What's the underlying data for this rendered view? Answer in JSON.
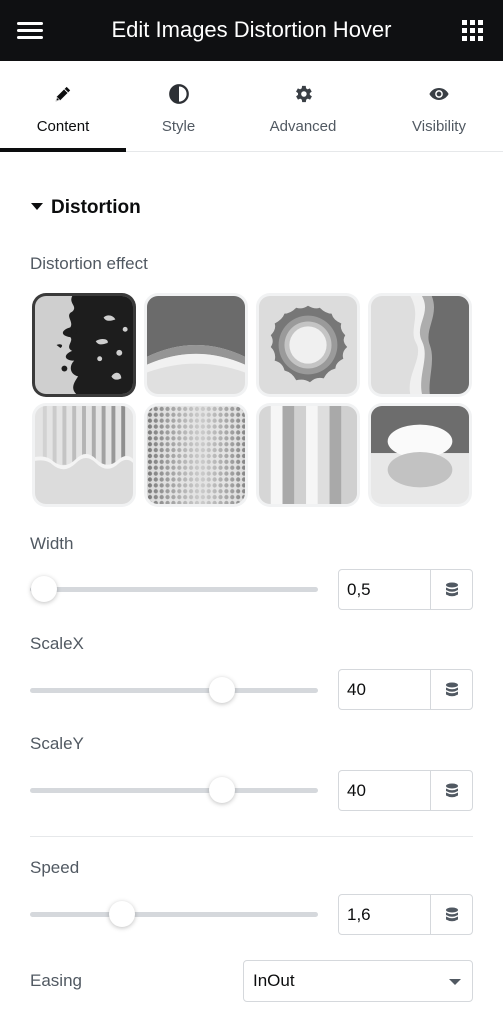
{
  "header": {
    "title": "Edit Images Distortion Hover",
    "menu_icon": "hamburger-icon",
    "apps_icon": "grid-icon"
  },
  "tabs": [
    {
      "label": "Content",
      "icon": "pencil-icon",
      "active": true
    },
    {
      "label": "Style",
      "icon": "half-circle-icon",
      "active": false
    },
    {
      "label": "Advanced",
      "icon": "gear-icon",
      "active": false
    },
    {
      "label": "Visibility",
      "icon": "eye-icon",
      "active": false
    }
  ],
  "section": {
    "title": "Distortion",
    "expanded": true
  },
  "distortion_effect": {
    "label": "Distortion effect",
    "options": [
      "ink-splatter",
      "arc-wave",
      "ripple-circle",
      "side-wave",
      "striped-wave",
      "halftone-dots",
      "vertical-stripes",
      "ellipse-reflection"
    ],
    "selected_index": 0
  },
  "controls": {
    "width": {
      "label": "Width",
      "value": "0,5",
      "fraction": 0.05
    },
    "scalex": {
      "label": "ScaleX",
      "value": "40",
      "fraction": 0.667
    },
    "scaley": {
      "label": "ScaleY",
      "value": "40",
      "fraction": 0.667
    },
    "speed": {
      "label": "Speed",
      "value": "1,6",
      "fraction": 0.32
    }
  },
  "dynamic_icon": "database-icon",
  "easing": {
    "label": "Easing",
    "value": "InOut"
  },
  "colors": {
    "header_bg": "#0f1012",
    "text_primary": "#0c0d0e",
    "text_secondary": "#515962",
    "border": "#d5d8dc"
  }
}
